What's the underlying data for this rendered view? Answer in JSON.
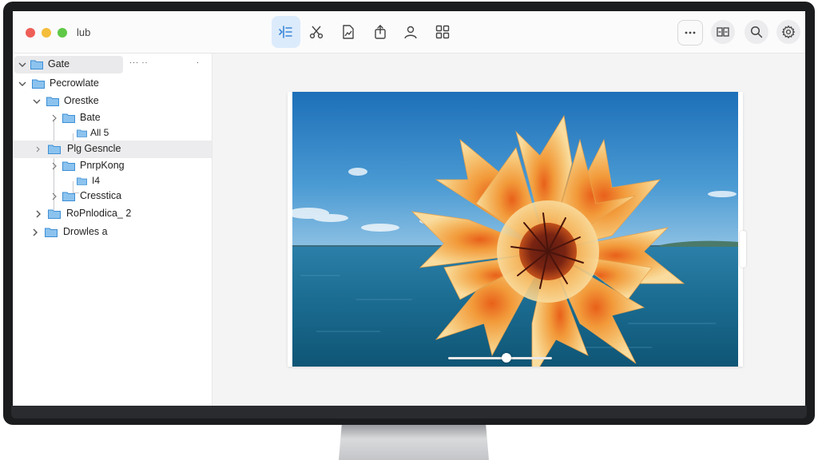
{
  "window": {
    "title": "lub"
  },
  "toolbar": {
    "tools": [
      {
        "icon": "sidebar-list-icon",
        "active": true
      },
      {
        "icon": "scissors-icon",
        "active": false
      },
      {
        "icon": "image-chart-icon",
        "active": false
      },
      {
        "icon": "share-icon",
        "active": false
      },
      {
        "icon": "person-icon",
        "active": false
      },
      {
        "icon": "grid-icon",
        "active": false
      }
    ],
    "right_buttons": [
      {
        "icon": "more-icon"
      },
      {
        "icon": "gallery-icon"
      },
      {
        "icon": "search-icon"
      },
      {
        "icon": "gear-icon"
      }
    ],
    "accent_color": "#dcebfb"
  },
  "sidebar": {
    "items": [
      {
        "label": "Gate",
        "extra": "···  ··",
        "extra2": "·"
      },
      {
        "label": "Pecrowlate"
      },
      {
        "label": "Orestke"
      },
      {
        "label": "Bate"
      },
      {
        "label": "All 5"
      },
      {
        "label": "Plg Gesncle"
      },
      {
        "label": "PnrpKong"
      },
      {
        "label": "I4"
      },
      {
        "label": "Cresstica"
      },
      {
        "label": "RoPnlodica_ 2"
      },
      {
        "label": "Drowles a"
      }
    ],
    "folder_color": "#6aaee6"
  },
  "viewer": {
    "image": "orange-flower-over-ocean",
    "zoom_slider_fraction": 0.56
  }
}
